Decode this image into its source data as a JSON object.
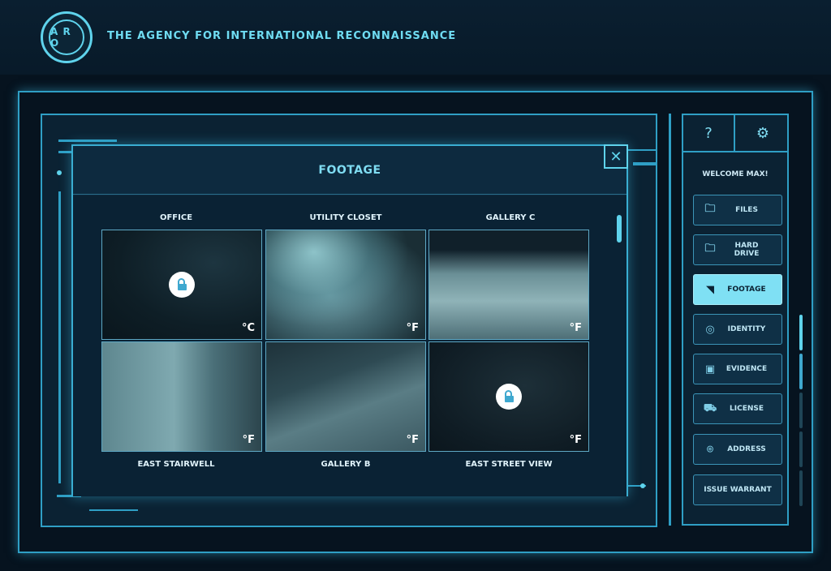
{
  "header": {
    "agency_title": "THE AGENCY FOR INTERNATIONAL RECONNAISSANCE",
    "logo_letters": "A R O",
    "logo_icon": "agency-seal-icon"
  },
  "modal": {
    "title": "FOOTAGE",
    "close_icon": "close-icon",
    "cameras": [
      {
        "name": "OFFICE",
        "temp": "°C",
        "locked": true
      },
      {
        "name": "UTILITY CLOSET",
        "temp": "°F",
        "locked": false
      },
      {
        "name": "GALLERY C",
        "temp": "°F",
        "locked": false
      },
      {
        "name": "EAST STAIRWELL",
        "temp": "°F",
        "locked": false
      },
      {
        "name": "GALLERY B",
        "temp": "°F",
        "locked": false
      },
      {
        "name": "EAST STREET VIEW",
        "temp": "°F",
        "locked": true
      }
    ]
  },
  "sidebar": {
    "help_label": "?",
    "settings_icon": "gear-icon",
    "welcome": "WELCOME MAX!",
    "items": [
      {
        "label": "FILES",
        "icon": "folder-icon"
      },
      {
        "label": "HARD DRIVE",
        "icon": "folder-icon"
      },
      {
        "label": "FOOTAGE",
        "icon": "camera-icon",
        "active": true
      },
      {
        "label": "IDENTITY",
        "icon": "fingerprint-icon"
      },
      {
        "label": "EVIDENCE",
        "icon": "evidence-icon"
      },
      {
        "label": "LICENSE",
        "icon": "car-icon"
      },
      {
        "label": "ADDRESS",
        "icon": "map-pin-icon"
      },
      {
        "label": "ISSUE WARRANT",
        "icon": ""
      }
    ]
  },
  "colors": {
    "accent": "#5fd3ec",
    "active_button": "#7fe0f4",
    "background": "#06131f"
  }
}
